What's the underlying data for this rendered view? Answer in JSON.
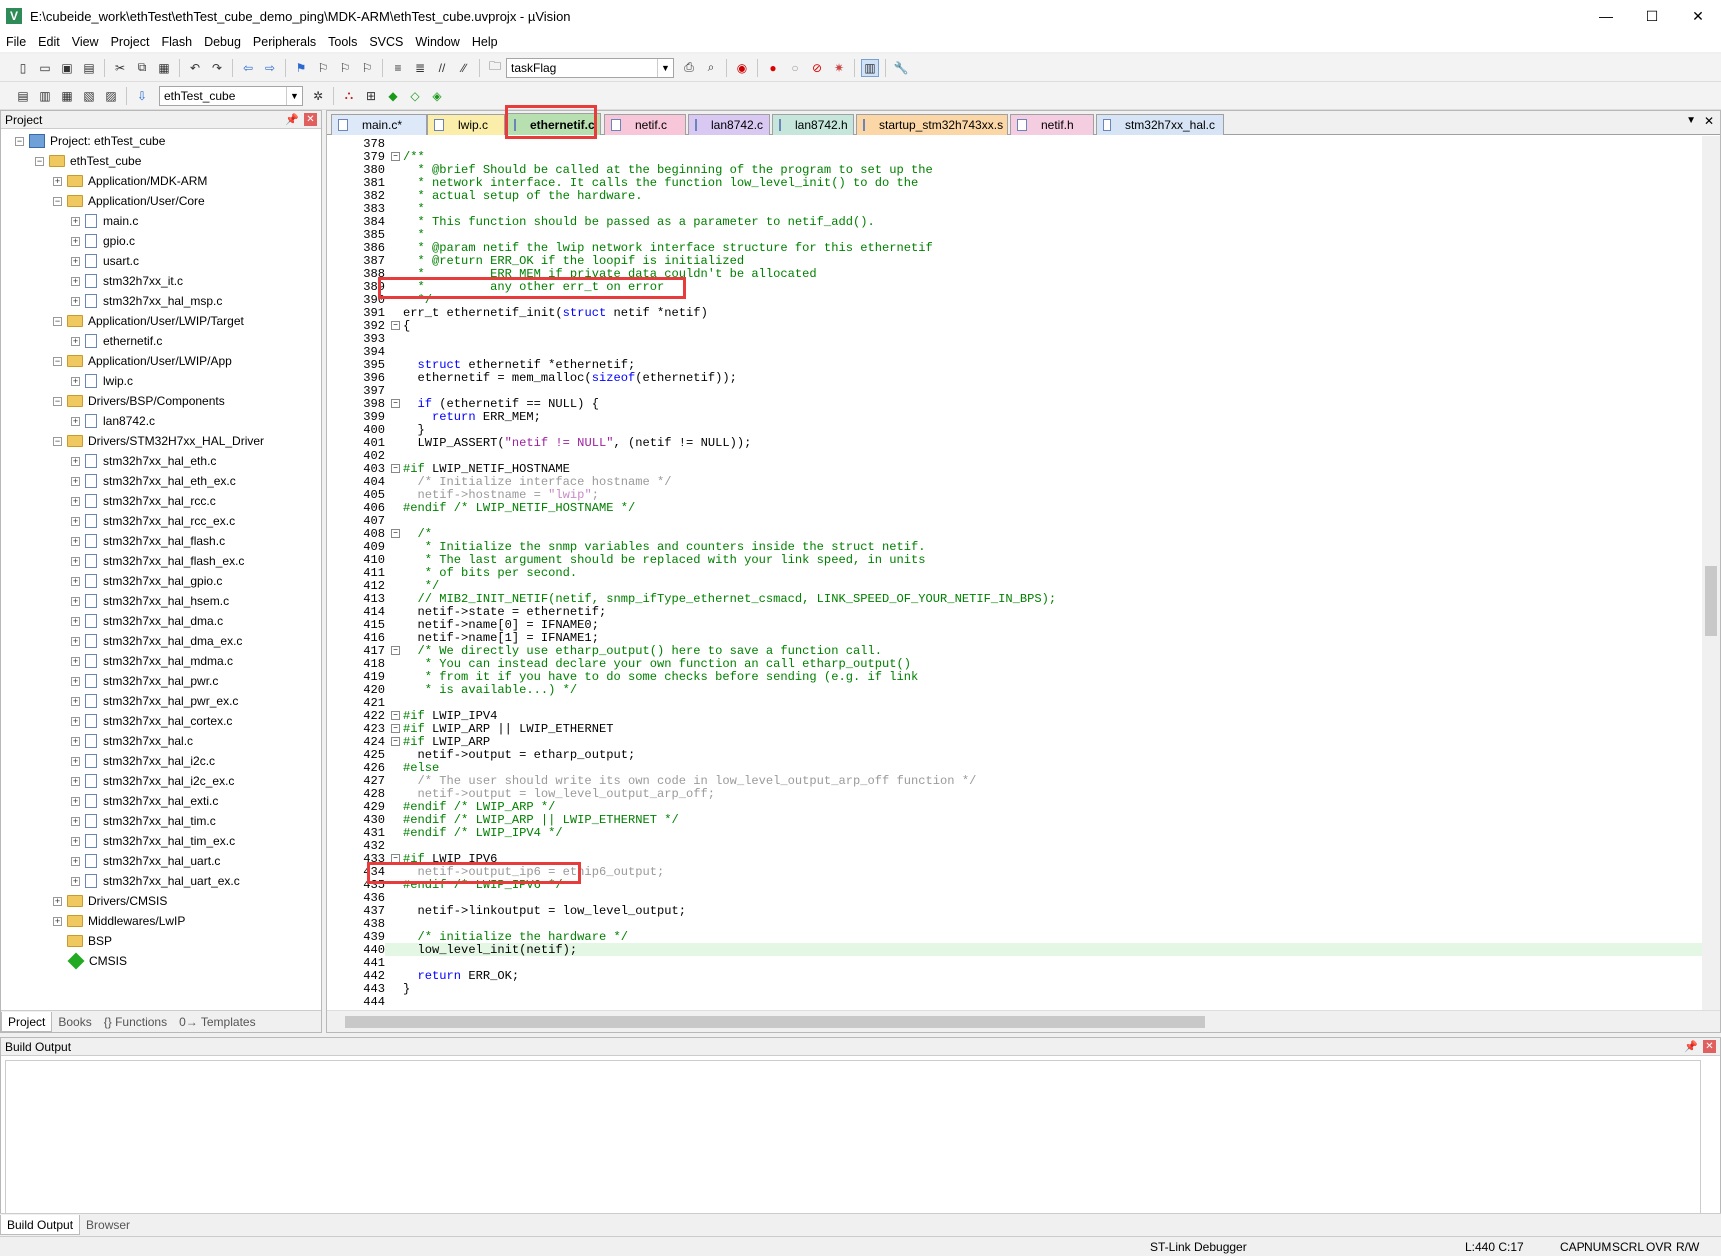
{
  "window": {
    "title": "E:\\cubeide_work\\ethTest\\ethTest_cube_demo_ping\\MDK-ARM\\ethTest_cube.uvprojx - µVision",
    "minimize": "—",
    "maximize": "☐",
    "close": "✕"
  },
  "menu": [
    "File",
    "Edit",
    "View",
    "Project",
    "Flash",
    "Debug",
    "Peripherals",
    "Tools",
    "SVCS",
    "Window",
    "Help"
  ],
  "toolbar": {
    "find_combo": "taskFlag",
    "target_combo": "ethTest_cube"
  },
  "project_panel": {
    "title": "Project",
    "tree": [
      {
        "label": "Project: ethTest_cube",
        "level": 0,
        "kind": "project",
        "expander": "−"
      },
      {
        "label": "ethTest_cube",
        "level": 1,
        "kind": "target",
        "expander": "−"
      },
      {
        "label": "Application/MDK-ARM",
        "level": 2,
        "kind": "folder",
        "expander": "+"
      },
      {
        "label": "Application/User/Core",
        "level": 2,
        "kind": "folder",
        "expander": "−"
      },
      {
        "label": "main.c",
        "level": 3,
        "kind": "file",
        "expander": "+"
      },
      {
        "label": "gpio.c",
        "level": 3,
        "kind": "file",
        "expander": "+"
      },
      {
        "label": "usart.c",
        "level": 3,
        "kind": "file",
        "expander": "+"
      },
      {
        "label": "stm32h7xx_it.c",
        "level": 3,
        "kind": "file",
        "expander": "+"
      },
      {
        "label": "stm32h7xx_hal_msp.c",
        "level": 3,
        "kind": "file",
        "expander": "+"
      },
      {
        "label": "Application/User/LWIP/Target",
        "level": 2,
        "kind": "folder",
        "expander": "−"
      },
      {
        "label": "ethernetif.c",
        "level": 3,
        "kind": "file",
        "expander": "+"
      },
      {
        "label": "Application/User/LWIP/App",
        "level": 2,
        "kind": "folder",
        "expander": "−"
      },
      {
        "label": "lwip.c",
        "level": 3,
        "kind": "file",
        "expander": "+"
      },
      {
        "label": "Drivers/BSP/Components",
        "level": 2,
        "kind": "folder",
        "expander": "−"
      },
      {
        "label": "lan8742.c",
        "level": 3,
        "kind": "file",
        "expander": "+"
      },
      {
        "label": "Drivers/STM32H7xx_HAL_Driver",
        "level": 2,
        "kind": "folder",
        "expander": "−"
      },
      {
        "label": "stm32h7xx_hal_eth.c",
        "level": 3,
        "kind": "file",
        "expander": "+"
      },
      {
        "label": "stm32h7xx_hal_eth_ex.c",
        "level": 3,
        "kind": "file",
        "expander": "+"
      },
      {
        "label": "stm32h7xx_hal_rcc.c",
        "level": 3,
        "kind": "file",
        "expander": "+"
      },
      {
        "label": "stm32h7xx_hal_rcc_ex.c",
        "level": 3,
        "kind": "file",
        "expander": "+"
      },
      {
        "label": "stm32h7xx_hal_flash.c",
        "level": 3,
        "kind": "file",
        "expander": "+"
      },
      {
        "label": "stm32h7xx_hal_flash_ex.c",
        "level": 3,
        "kind": "file",
        "expander": "+"
      },
      {
        "label": "stm32h7xx_hal_gpio.c",
        "level": 3,
        "kind": "file",
        "expander": "+"
      },
      {
        "label": "stm32h7xx_hal_hsem.c",
        "level": 3,
        "kind": "file",
        "expander": "+"
      },
      {
        "label": "stm32h7xx_hal_dma.c",
        "level": 3,
        "kind": "file",
        "expander": "+"
      },
      {
        "label": "stm32h7xx_hal_dma_ex.c",
        "level": 3,
        "kind": "file",
        "expander": "+"
      },
      {
        "label": "stm32h7xx_hal_mdma.c",
        "level": 3,
        "kind": "file",
        "expander": "+"
      },
      {
        "label": "stm32h7xx_hal_pwr.c",
        "level": 3,
        "kind": "file",
        "expander": "+"
      },
      {
        "label": "stm32h7xx_hal_pwr_ex.c",
        "level": 3,
        "kind": "file",
        "expander": "+"
      },
      {
        "label": "stm32h7xx_hal_cortex.c",
        "level": 3,
        "kind": "file",
        "expander": "+"
      },
      {
        "label": "stm32h7xx_hal.c",
        "level": 3,
        "kind": "file",
        "expander": "+"
      },
      {
        "label": "stm32h7xx_hal_i2c.c",
        "level": 3,
        "kind": "file",
        "expander": "+"
      },
      {
        "label": "stm32h7xx_hal_i2c_ex.c",
        "level": 3,
        "kind": "file",
        "expander": "+"
      },
      {
        "label": "stm32h7xx_hal_exti.c",
        "level": 3,
        "kind": "file",
        "expander": "+"
      },
      {
        "label": "stm32h7xx_hal_tim.c",
        "level": 3,
        "kind": "file",
        "expander": "+"
      },
      {
        "label": "stm32h7xx_hal_tim_ex.c",
        "level": 3,
        "kind": "file",
        "expander": "+"
      },
      {
        "label": "stm32h7xx_hal_uart.c",
        "level": 3,
        "kind": "file",
        "expander": "+"
      },
      {
        "label": "stm32h7xx_hal_uart_ex.c",
        "level": 3,
        "kind": "file",
        "expander": "+"
      },
      {
        "label": "Drivers/CMSIS",
        "level": 2,
        "kind": "folder",
        "expander": "+"
      },
      {
        "label": "Middlewares/LwIP",
        "level": 2,
        "kind": "folder",
        "expander": "+"
      },
      {
        "label": "BSP",
        "level": 2,
        "kind": "folder",
        "expander": ""
      },
      {
        "label": "CMSIS",
        "level": 2,
        "kind": "component",
        "expander": ""
      }
    ],
    "tabs": [
      "Project",
      "Books",
      "{} Functions",
      "0→ Templates"
    ]
  },
  "editor": {
    "tabs": [
      {
        "label": "main.c*",
        "color": "#dde8f8",
        "active": false
      },
      {
        "label": "lwip.c",
        "color": "#fbeeaa",
        "active": false
      },
      {
        "label": "ethernetif.c",
        "color": "#b7dfb0",
        "active": true
      },
      {
        "label": "netif.c",
        "color": "#f7c6d8",
        "active": false
      },
      {
        "label": "lan8742.c",
        "color": "#d8c8f2",
        "active": false
      },
      {
        "label": "lan8742.h",
        "color": "#c6e6dc",
        "active": false
      },
      {
        "label": "startup_stm32h743xx.s",
        "color": "#fbd7a8",
        "active": false
      },
      {
        "label": "netif.h",
        "color": "#f5cde0",
        "active": false
      },
      {
        "label": "stm32h7xx_hal.c",
        "color": "#d6e4f6",
        "active": false
      }
    ],
    "lines": [
      {
        "n": "378",
        "f": "",
        "t": [
          [
            "",
            ""
          ]
        ]
      },
      {
        "n": "379",
        "f": "−",
        "t": [
          [
            "c-com",
            "/**"
          ]
        ]
      },
      {
        "n": "380",
        "f": "",
        "t": [
          [
            "c-com",
            "  * @brief Should be called at the beginning of the program to set up the"
          ]
        ]
      },
      {
        "n": "381",
        "f": "",
        "t": [
          [
            "c-com",
            "  * network interface. It calls the function low_level_init() to do the"
          ]
        ]
      },
      {
        "n": "382",
        "f": "",
        "t": [
          [
            "c-com",
            "  * actual setup of the hardware."
          ]
        ]
      },
      {
        "n": "383",
        "f": "",
        "t": [
          [
            "c-com",
            "  *"
          ]
        ]
      },
      {
        "n": "384",
        "f": "",
        "t": [
          [
            "c-com",
            "  * This function should be passed as a parameter to netif_add()."
          ]
        ]
      },
      {
        "n": "385",
        "f": "",
        "t": [
          [
            "c-com",
            "  *"
          ]
        ]
      },
      {
        "n": "386",
        "f": "",
        "t": [
          [
            "c-com",
            "  * @param netif the lwip network interface structure for this ethernetif"
          ]
        ]
      },
      {
        "n": "387",
        "f": "",
        "t": [
          [
            "c-com",
            "  * @return ERR_OK if the loopif is initialized"
          ]
        ]
      },
      {
        "n": "388",
        "f": "",
        "t": [
          [
            "c-com",
            "  *         ERR_MEM if private data couldn't be allocated"
          ]
        ]
      },
      {
        "n": "389",
        "f": "",
        "t": [
          [
            "c-com",
            "  *         any other err_t on error"
          ]
        ]
      },
      {
        "n": "390",
        "f": "",
        "t": [
          [
            "c-com",
            "  */"
          ]
        ]
      },
      {
        "n": "391",
        "f": "",
        "t": [
          [
            "",
            "err_t ethernetif_init("
          ],
          [
            "c-kw",
            "struct"
          ],
          [
            "",
            " netif *netif)"
          ]
        ]
      },
      {
        "n": "392",
        "f": "−",
        "t": [
          [
            "",
            "{"
          ]
        ]
      },
      {
        "n": "393",
        "f": "",
        "t": [
          [
            "",
            ""
          ]
        ]
      },
      {
        "n": "394",
        "f": "",
        "t": [
          [
            "",
            ""
          ]
        ]
      },
      {
        "n": "395",
        "f": "",
        "t": [
          [
            "",
            "  "
          ],
          [
            "c-kw",
            "struct"
          ],
          [
            "",
            " ethernetif *ethernetif;"
          ]
        ]
      },
      {
        "n": "396",
        "f": "",
        "t": [
          [
            "",
            "  ethernetif = mem_malloc("
          ],
          [
            "c-kw",
            "sizeof"
          ],
          [
            "",
            "(ethernetif));"
          ]
        ]
      },
      {
        "n": "397",
        "f": "",
        "t": [
          [
            "",
            ""
          ]
        ]
      },
      {
        "n": "398",
        "f": "−",
        "t": [
          [
            "",
            "  "
          ],
          [
            "c-kw",
            "if"
          ],
          [
            "",
            " (ethernetif == NULL) {"
          ]
        ]
      },
      {
        "n": "399",
        "f": "",
        "t": [
          [
            "",
            "    "
          ],
          [
            "c-kw",
            "return"
          ],
          [
            "",
            " ERR_MEM;"
          ]
        ]
      },
      {
        "n": "400",
        "f": "",
        "t": [
          [
            "",
            "  }"
          ]
        ]
      },
      {
        "n": "401",
        "f": "",
        "t": [
          [
            "",
            "  LWIP_ASSERT("
          ],
          [
            "c-str",
            "\"netif != NULL\""
          ],
          [
            "",
            ", (netif != NULL));"
          ]
        ]
      },
      {
        "n": "402",
        "f": "",
        "t": [
          [
            "",
            ""
          ]
        ]
      },
      {
        "n": "403",
        "f": "−",
        "t": [
          [
            "c-pp",
            "#if"
          ],
          [
            "",
            " LWIP_NETIF_HOSTNAME"
          ]
        ]
      },
      {
        "n": "404",
        "f": "",
        "t": [
          [
            "c-dim",
            "  /* Initialize interface hostname */"
          ]
        ]
      },
      {
        "n": "405",
        "f": "",
        "t": [
          [
            "c-dim",
            "  netif->hostname = "
          ],
          [
            "c-dimstr",
            "\"lwip\""
          ],
          [
            "c-dim",
            ";"
          ]
        ]
      },
      {
        "n": "406",
        "f": "",
        "t": [
          [
            "c-pp",
            "#endif /* LWIP_NETIF_HOSTNAME */"
          ]
        ]
      },
      {
        "n": "407",
        "f": "",
        "t": [
          [
            "",
            ""
          ]
        ]
      },
      {
        "n": "408",
        "f": "−",
        "t": [
          [
            "c-com",
            "  /*"
          ]
        ]
      },
      {
        "n": "409",
        "f": "",
        "t": [
          [
            "c-com",
            "   * Initialize the snmp variables and counters inside the struct netif."
          ]
        ]
      },
      {
        "n": "410",
        "f": "",
        "t": [
          [
            "c-com",
            "   * The last argument should be replaced with your link speed, in units"
          ]
        ]
      },
      {
        "n": "411",
        "f": "",
        "t": [
          [
            "c-com",
            "   * of bits per second."
          ]
        ]
      },
      {
        "n": "412",
        "f": "",
        "t": [
          [
            "c-com",
            "   */"
          ]
        ]
      },
      {
        "n": "413",
        "f": "",
        "t": [
          [
            "c-com",
            "  // MIB2_INIT_NETIF(netif, snmp_ifType_ethernet_csmacd, LINK_SPEED_OF_YOUR_NETIF_IN_BPS);"
          ]
        ]
      },
      {
        "n": "414",
        "f": "",
        "t": [
          [
            "",
            "  netif->state = ethernetif;"
          ]
        ]
      },
      {
        "n": "415",
        "f": "",
        "t": [
          [
            "",
            "  netif->name[0] = IFNAME0;"
          ]
        ]
      },
      {
        "n": "416",
        "f": "",
        "t": [
          [
            "",
            "  netif->name[1] = IFNAME1;"
          ]
        ]
      },
      {
        "n": "417",
        "f": "−",
        "t": [
          [
            "c-com",
            "  /* We directly use etharp_output() here to save a function call."
          ]
        ]
      },
      {
        "n": "418",
        "f": "",
        "t": [
          [
            "c-com",
            "   * You can instead declare your own function an call etharp_output()"
          ]
        ]
      },
      {
        "n": "419",
        "f": "",
        "t": [
          [
            "c-com",
            "   * from it if you have to do some checks before sending (e.g. if link"
          ]
        ]
      },
      {
        "n": "420",
        "f": "",
        "t": [
          [
            "c-com",
            "   * is available...) */"
          ]
        ]
      },
      {
        "n": "421",
        "f": "",
        "t": [
          [
            "",
            ""
          ]
        ]
      },
      {
        "n": "422",
        "f": "−",
        "t": [
          [
            "c-pp",
            "#if"
          ],
          [
            "",
            " LWIP_IPV4"
          ]
        ]
      },
      {
        "n": "423",
        "f": "−",
        "t": [
          [
            "c-pp",
            "#if"
          ],
          [
            "",
            " LWIP_ARP || LWIP_ETHERNET"
          ]
        ]
      },
      {
        "n": "424",
        "f": "−",
        "t": [
          [
            "c-pp",
            "#if"
          ],
          [
            "",
            " LWIP_ARP"
          ]
        ]
      },
      {
        "n": "425",
        "f": "",
        "t": [
          [
            "",
            "  netif->output = etharp_output;"
          ]
        ]
      },
      {
        "n": "426",
        "f": "",
        "t": [
          [
            "c-pp",
            "#else"
          ]
        ]
      },
      {
        "n": "427",
        "f": "",
        "t": [
          [
            "c-dim",
            "  /* The user should write its own code in low_level_output_arp_off function */"
          ]
        ]
      },
      {
        "n": "428",
        "f": "",
        "t": [
          [
            "c-dim",
            "  netif->output = low_level_output_arp_off;"
          ]
        ]
      },
      {
        "n": "429",
        "f": "",
        "t": [
          [
            "c-pp",
            "#endif /* LWIP_ARP */"
          ]
        ]
      },
      {
        "n": "430",
        "f": "",
        "t": [
          [
            "c-pp",
            "#endif /* LWIP_ARP || LWIP_ETHERNET */"
          ]
        ]
      },
      {
        "n": "431",
        "f": "",
        "t": [
          [
            "c-pp",
            "#endif /* LWIP_IPV4 */"
          ]
        ]
      },
      {
        "n": "432",
        "f": "",
        "t": [
          [
            "",
            ""
          ]
        ]
      },
      {
        "n": "433",
        "f": "−",
        "t": [
          [
            "c-pp",
            "#if"
          ],
          [
            "",
            " LWIP_IPV6"
          ]
        ]
      },
      {
        "n": "434",
        "f": "",
        "t": [
          [
            "c-dim",
            "  netif->output_ip6 = ethip6_output;"
          ]
        ]
      },
      {
        "n": "435",
        "f": "",
        "t": [
          [
            "c-pp",
            "#endif /* LWIP_IPV6 */"
          ]
        ]
      },
      {
        "n": "436",
        "f": "",
        "t": [
          [
            "",
            ""
          ]
        ]
      },
      {
        "n": "437",
        "f": "",
        "t": [
          [
            "",
            "  netif->linkoutput = low_level_output;"
          ]
        ]
      },
      {
        "n": "438",
        "f": "",
        "t": [
          [
            "",
            ""
          ]
        ]
      },
      {
        "n": "439",
        "f": "",
        "t": [
          [
            "c-com",
            "  /* initialize the hardware */"
          ]
        ]
      },
      {
        "n": "440",
        "f": "",
        "t": [
          [
            "",
            "  low_level_init(netif);"
          ]
        ]
      },
      {
        "n": "441",
        "f": "",
        "t": [
          [
            "",
            ""
          ]
        ]
      },
      {
        "n": "442",
        "f": "",
        "t": [
          [
            "",
            "  "
          ],
          [
            "c-kw",
            "return"
          ],
          [
            "",
            " ERR_OK;"
          ]
        ]
      },
      {
        "n": "443",
        "f": "",
        "t": [
          [
            "",
            "}"
          ]
        ]
      },
      {
        "n": "444",
        "f": "",
        "t": [
          [
            "",
            ""
          ]
        ]
      }
    ]
  },
  "build_output": {
    "title": "Build Output",
    "tabs": [
      "Build Output",
      "Browser"
    ]
  },
  "status": {
    "debugger": "ST-Link Debugger",
    "position": "L:440 C:17",
    "indicators": [
      "CAP",
      "NUM",
      "SCRL",
      "OVR",
      "R/W"
    ]
  }
}
